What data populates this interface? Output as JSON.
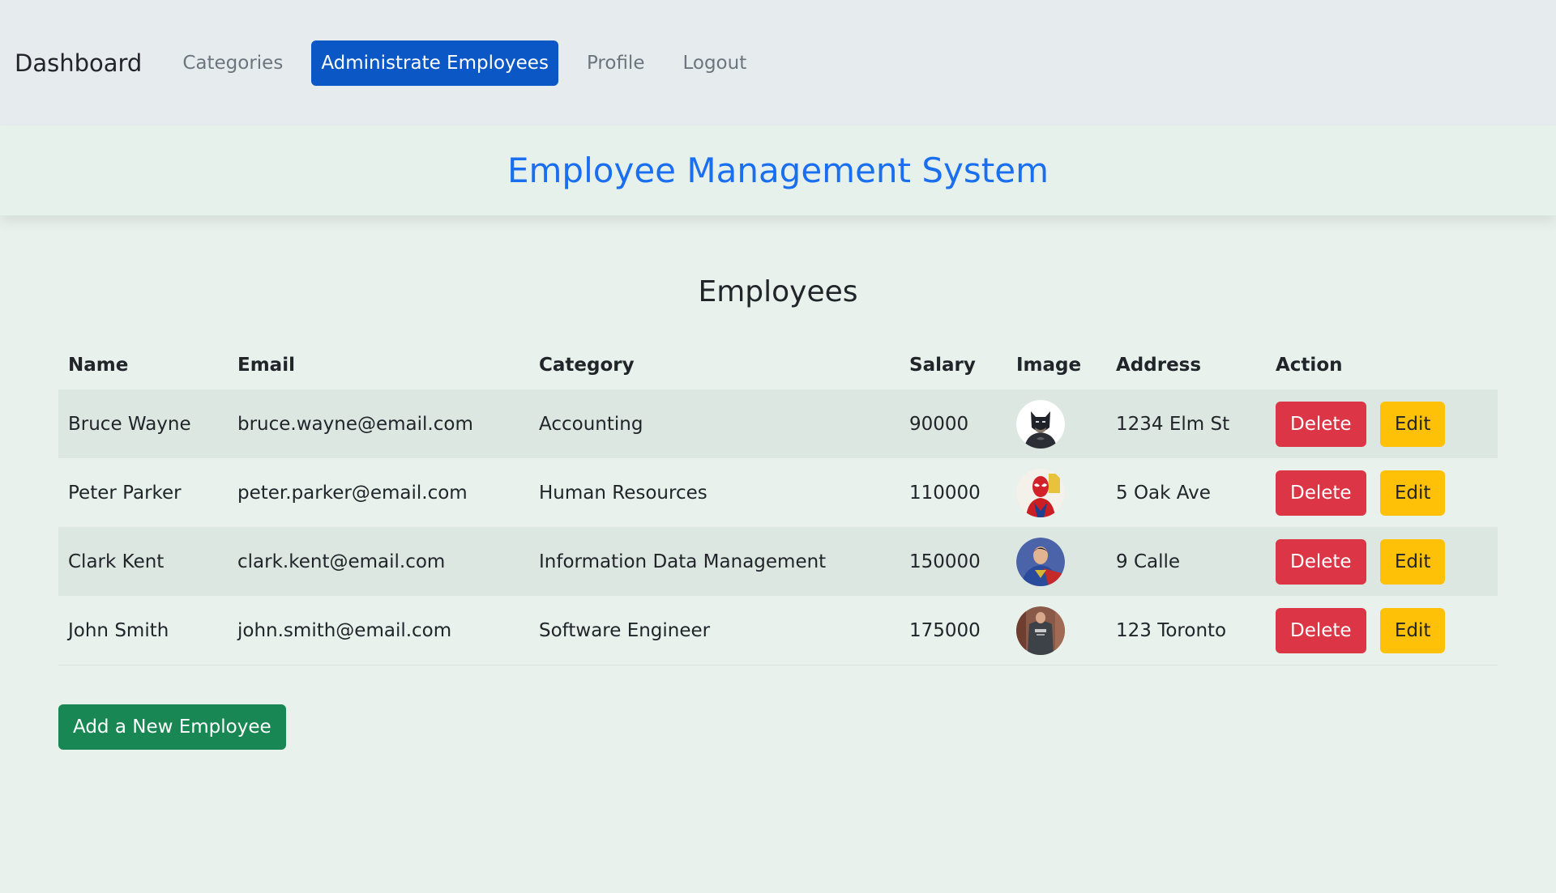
{
  "nav": {
    "brand": "Dashboard",
    "links": [
      "Categories",
      "Administrate Employees",
      "Profile",
      "Logout"
    ],
    "active_index": 1
  },
  "header": {
    "title": "Employee Management System"
  },
  "main": {
    "section_title": "Employees",
    "table": {
      "columns": [
        "Name",
        "Email",
        "Category",
        "Salary",
        "Image",
        "Address",
        "Action"
      ],
      "rows": [
        {
          "name": "Bruce Wayne",
          "email": "bruce.wayne@email.com",
          "category": "Accounting",
          "salary": "90000",
          "address": "1234 Elm St",
          "image": "batman-avatar-icon"
        },
        {
          "name": "Peter Parker",
          "email": "peter.parker@email.com",
          "category": "Human Resources",
          "salary": "110000",
          "address": "5 Oak Ave",
          "image": "spiderman-avatar-icon"
        },
        {
          "name": "Clark Kent",
          "email": "clark.kent@email.com",
          "category": "Information Data Management",
          "salary": "150000",
          "address": "9 Calle",
          "image": "superman-avatar-icon"
        },
        {
          "name": "John Smith",
          "email": "john.smith@email.com",
          "category": "Software Engineer",
          "salary": "175000",
          "address": "123 Toronto",
          "image": "person-avatar-icon"
        }
      ],
      "delete_label": "Delete",
      "edit_label": "Edit"
    },
    "add_button_label": "Add a New Employee"
  },
  "colors": {
    "active_nav": "#0b57c5",
    "title": "#1a6ef0",
    "delete": "#dc3545",
    "edit": "#ffc107",
    "add": "#198754"
  }
}
